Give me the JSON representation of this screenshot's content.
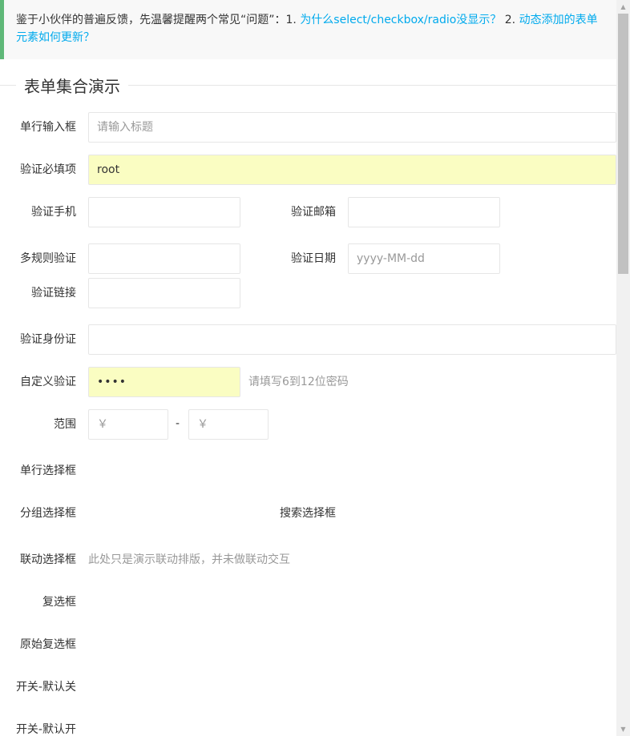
{
  "tip": {
    "text_before": "鉴于小伙伴的普遍反馈，先温馨提醒两个常见“问题”：1. ",
    "link1": "为什么select/checkbox/radio没显示？",
    "text_mid": " 2. ",
    "link2": "动态添加的表单元素如何更新？"
  },
  "legend": "表单集合演示",
  "form": {
    "title": {
      "label": "单行输入框",
      "placeholder": "请输入标题"
    },
    "required": {
      "label": "验证必填项",
      "value": "root"
    },
    "phone": {
      "label": "验证手机",
      "value": ""
    },
    "email": {
      "label": "验证邮箱",
      "value": ""
    },
    "multi_rule": {
      "label": "多规则验证",
      "value": ""
    },
    "date": {
      "label": "验证日期",
      "placeholder": "yyyy-MM-dd"
    },
    "url": {
      "label": "验证链接",
      "value": ""
    },
    "identity": {
      "label": "验证身份证",
      "value": ""
    },
    "custom": {
      "label": "自定义验证",
      "value": "••••",
      "hint": "请填写6到12位密码"
    },
    "range": {
      "label": "范围",
      "min_placeholder": "￥",
      "separator": "-",
      "max_placeholder": "￥"
    },
    "select_single": {
      "label": "单行选择框"
    },
    "select_group": {
      "label": "分组选择框"
    },
    "select_search": {
      "label": "搜索选择框"
    },
    "select_linked": {
      "label": "联动选择框",
      "hint": "此处只是演示联动排版，并未做联动交互"
    },
    "checkbox": {
      "label": "复选框"
    },
    "checkbox_raw": {
      "label": "原始复选框"
    },
    "switch_off": {
      "label": "开关-默认关"
    },
    "switch_on": {
      "label": "开关-默认开"
    }
  }
}
